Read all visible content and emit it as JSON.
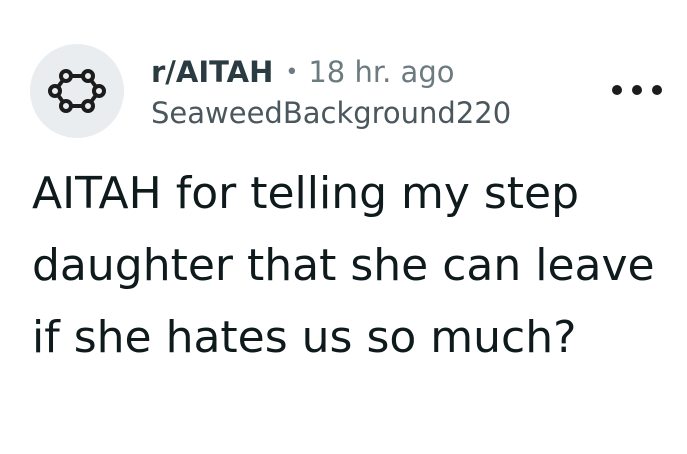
{
  "post": {
    "subreddit": "r/AITAH",
    "separator": "•",
    "time_ago": "18 hr. ago",
    "author": "SeaweedBackground220",
    "title": "AITAH for telling my step daughter that she can leave if she hates us so much?",
    "icons": {
      "avatar": "subreddit-ring-icon",
      "more": "more-options-icon"
    }
  }
}
